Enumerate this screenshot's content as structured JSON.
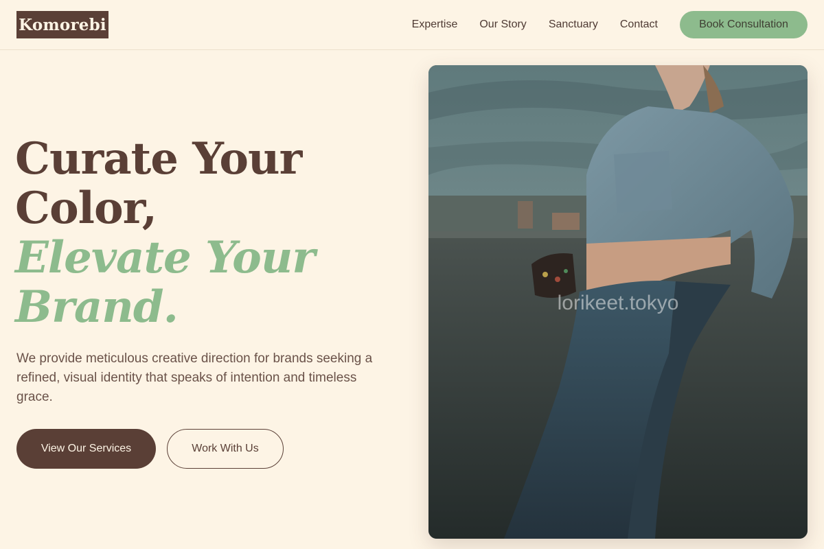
{
  "brand": {
    "name": "Komorebi"
  },
  "nav": {
    "items": [
      "Expertise",
      "Our Story",
      "Sanctuary",
      "Contact"
    ],
    "cta_label": "Book Consultation"
  },
  "hero": {
    "title_line1": "Curate Your",
    "title_line2": "Color,",
    "title_line3": "Elevate Your",
    "title_line4": "Brand.",
    "lede": "We provide meticulous creative direction for brands seeking a refined, visual identity that speaks of intention and timeless grace.",
    "primary_button": "View Our Services",
    "secondary_button": "Work With Us"
  },
  "photo": {
    "watermark": "lorikeet.tokyo"
  },
  "colors": {
    "background": "#fdf4e5",
    "brown": "#5a3f36",
    "sage": "#8dbb8d"
  }
}
